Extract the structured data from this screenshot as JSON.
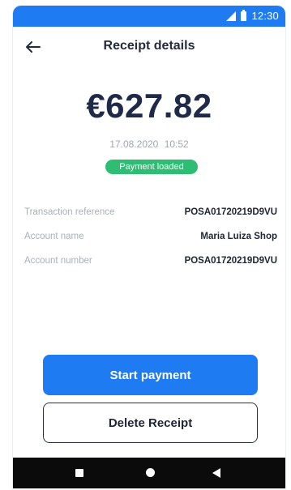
{
  "status_bar": {
    "time": "12:30",
    "icons": [
      "signal-icon",
      "battery-icon"
    ]
  },
  "header": {
    "title": "Receipt details",
    "back_icon": "arrow-left-icon"
  },
  "receipt": {
    "amount": "€627.82",
    "date": "17.08.2020",
    "time": "10:52",
    "status": "Payment loaded"
  },
  "details": [
    {
      "label": "Transaction reference",
      "value": "POSA01720219D9VU"
    },
    {
      "label": "Account name",
      "value": "Maria Luiza Shop"
    },
    {
      "label": "Account number",
      "value": "POSA01720219D9VU"
    }
  ],
  "actions": {
    "primary_label": "Start payment",
    "secondary_label": "Delete Receipt"
  },
  "navigation": {
    "icons": [
      "recents-icon",
      "home-icon",
      "back-icon"
    ]
  },
  "colors": {
    "accent": "#1f7bf2",
    "success": "#2ebd73",
    "text_dark": "#1e2a47",
    "text_muted": "#a0a6b2"
  }
}
